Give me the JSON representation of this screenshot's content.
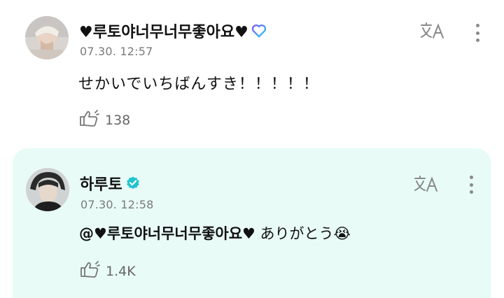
{
  "comments": [
    {
      "author": "♥루토야너무너무좋아요♥",
      "timestamp": "07.30. 12:57",
      "text": "せかいでいちばんすき！！！！！",
      "like_count": "138",
      "badge_icon": "membership-heart-icon",
      "highlighted": false
    },
    {
      "author": "하루토",
      "timestamp": "07.30. 12:58",
      "mention": "@♥루토야너무너무좋아요♥",
      "text": "ありがとう",
      "emoji": "😭",
      "like_count": "1.4K",
      "badge_icon": "verified-check-icon",
      "highlighted": true
    }
  ],
  "colors": {
    "highlight_bg": "#e8fbf7",
    "verified": "#1fc3d0",
    "membership_gradient": [
      "#7a5cff",
      "#2ecbe6"
    ],
    "meta_text": "#7a7a7a"
  }
}
